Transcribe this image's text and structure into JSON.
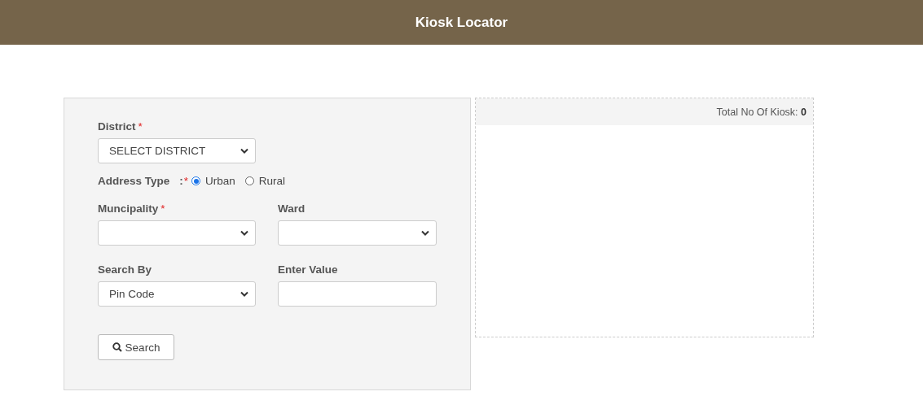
{
  "header": {
    "title": "Kiosk Locator"
  },
  "form": {
    "district": {
      "label": "District",
      "required_mark": "*",
      "value": "SELECT DISTRICT"
    },
    "address_type": {
      "label": "Address Type",
      "separator": ":",
      "required_mark": "*",
      "options": [
        {
          "label": "Urban",
          "selected": true
        },
        {
          "label": "Rural",
          "selected": false
        }
      ]
    },
    "municipality": {
      "label": "Muncipality",
      "required_mark": "*"
    },
    "ward": {
      "label": "Ward"
    },
    "search_by": {
      "label": "Search By",
      "value": "Pin Code"
    },
    "enter_value": {
      "label": "Enter Value"
    },
    "search_button": {
      "label": "Search"
    }
  },
  "results": {
    "total": "Total No Of Kiosk: **0**"
  }
}
